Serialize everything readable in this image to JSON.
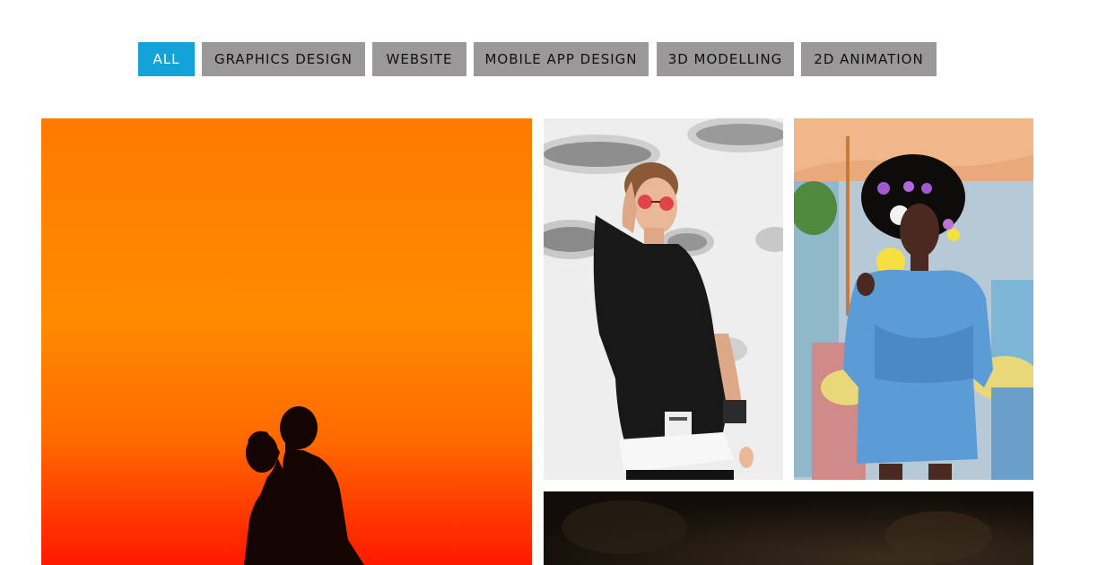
{
  "filters": [
    {
      "label": "ALL",
      "active": true
    },
    {
      "label": "GRAPHICS DESIGN",
      "active": false
    },
    {
      "label": "WEBSITE",
      "active": false
    },
    {
      "label": "MOBILE APP DESIGN",
      "active": false
    },
    {
      "label": "3D MODELLING",
      "active": false
    },
    {
      "label": "2D ANIMATION",
      "active": false
    }
  ],
  "colors": {
    "active_filter_bg": "#14a3d8",
    "inactive_filter_bg": "#9a9898"
  },
  "gallery": [
    {
      "subject": "silhouette of couple against orange sunset sky"
    },
    {
      "subject": "woman in black t-shirt and red sunglasses against white wall"
    },
    {
      "subject": "woman with afro and flowers in denim jacket under umbrella"
    },
    {
      "subject": "dark photo"
    }
  ]
}
